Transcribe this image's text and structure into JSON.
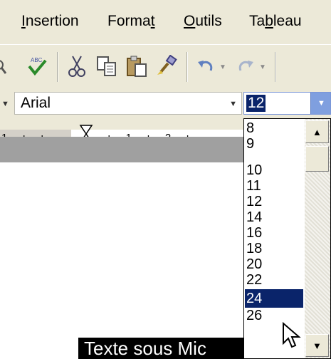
{
  "menu": {
    "items": [
      {
        "pre": "",
        "mnemonic": "I",
        "post": "nsertion"
      },
      {
        "pre": "Forma",
        "mnemonic": "t",
        "post": ""
      },
      {
        "pre": "",
        "mnemonic": "O",
        "post": "utils"
      },
      {
        "pre": "Ta",
        "mnemonic": "b",
        "post": "leau"
      }
    ]
  },
  "toolbar": {
    "icons": [
      "spelling-icon",
      "cut-icon",
      "copy-icon",
      "paste-icon",
      "format-painter-icon",
      "undo-icon",
      "redo-icon"
    ],
    "dropdown_glyph": "▼"
  },
  "formatting": {
    "font_name": "Arial",
    "font_size": "12",
    "arrow_glyph": "▼"
  },
  "ruler": {
    "left_text": "1 · ı · ı",
    "right_text": "· ı · 1 · ı · 2 · ı ·"
  },
  "size_list": {
    "options": [
      "8",
      "9",
      "10",
      "11",
      "12",
      "14",
      "16",
      "18",
      "20",
      "22",
      "24",
      "26"
    ],
    "highlighted": "24",
    "up_glyph": "▲",
    "down_glyph": "▼"
  },
  "document": {
    "text": "Texte sous Mic"
  }
}
